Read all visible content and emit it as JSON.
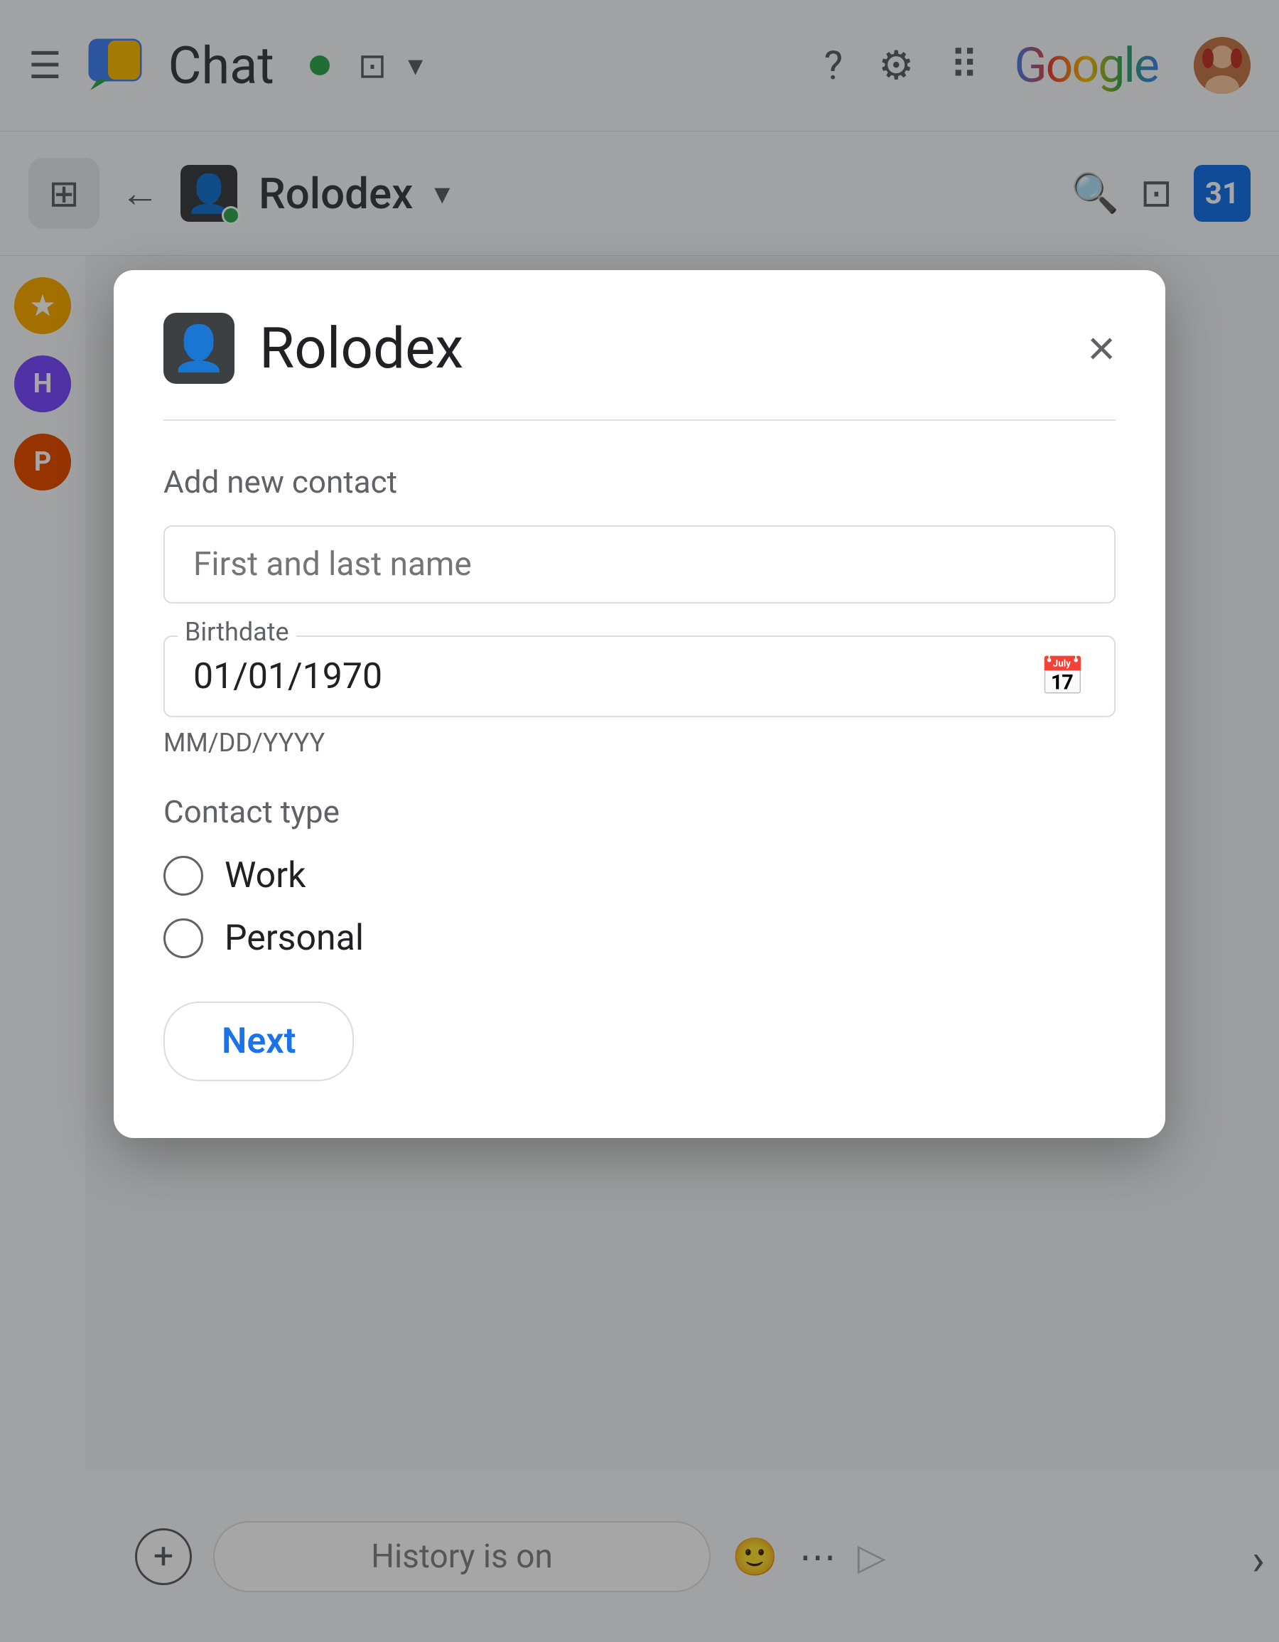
{
  "header": {
    "app_title": "Chat",
    "hamburger_label": "☰",
    "status_online": "online",
    "google_label": "Google",
    "window_icon": "⊟"
  },
  "nav": {
    "new_chat_icon": "⊞",
    "back_arrow": "←",
    "channel_name": "Rolodex",
    "chevron": "∨",
    "search_icon": "🔍",
    "picture_icon": "⊡",
    "calendar_number": "31"
  },
  "modal": {
    "title": "Rolodex",
    "close_label": "×",
    "section_label": "Add new contact",
    "name_placeholder": "First and last name",
    "birthdate_label": "Birthdate",
    "birthdate_value": "01/01/1970",
    "date_format_hint": "MM/DD/YYYY",
    "contact_type_label": "Contact type",
    "radio_options": [
      {
        "id": "work",
        "label": "Work"
      },
      {
        "id": "personal",
        "label": "Personal"
      }
    ],
    "next_button_label": "Next"
  },
  "bottom_bar": {
    "add_icon": "+",
    "history_text": "History is on",
    "emoji_icon": "🙂",
    "more_icon": "⋯",
    "send_icon": "▷"
  },
  "sidebar": {
    "items": [
      {
        "id": "yellow",
        "label": "★",
        "color": "sidebar-item-yellow"
      },
      {
        "id": "h",
        "label": "H",
        "color": "sidebar-item-h"
      },
      {
        "id": "p",
        "label": "P",
        "color": "sidebar-item-p"
      }
    ]
  }
}
